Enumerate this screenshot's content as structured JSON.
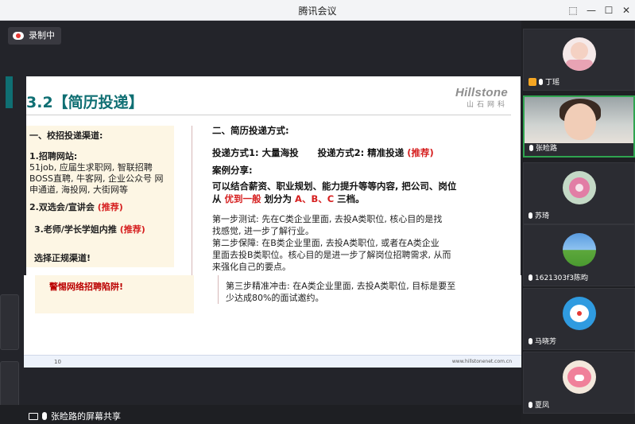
{
  "window": {
    "title": "腾讯会议",
    "controls": [
      "pin-icon",
      "minimize-icon",
      "maximize-icon",
      "close-icon"
    ]
  },
  "recording": {
    "label": "录制中"
  },
  "slide": {
    "heading": "3.2【简历投递】",
    "brand_name": "Hillstone",
    "brand_sub": "山石网科",
    "left": {
      "title": "一、校招投递渠道:",
      "item1_title": "1.招聘网站:",
      "item1_body": "51job, 应届生求职网, 智联招聘 BOSS直聘, 牛客网, 企业公众号 网申通道, 海投网, 大街网等",
      "item2_text": "2.双选会/宣讲会",
      "item2_tag": "(推荐)",
      "item3_text": "3.老师/学长学姐内推",
      "item3_tag": "(推荐)",
      "item4_text": "选择正规渠道!",
      "warning": "警惕网络招聘陷阱!"
    },
    "right": {
      "title": "二、简历投递方式:",
      "method1": "投递方式1: 大量海投",
      "method2": "投递方式2: 精准投递",
      "method2_tag": "(推荐)",
      "case_title": "案例分享:",
      "case_line1": "可以结合薪资、职业规划、能力提升等等内容, 把公司、岗位",
      "case_line2_prefix": "从",
      "case_line2_red1": "优到一般",
      "case_line2_mid": "划分为",
      "case_line2_red2": "A、B、C",
      "case_line2_suffix": "三档。",
      "step1": "第一步测试: 先在C类企业里面, 去投A类职位, 核心目的是找",
      "step1b": "找感觉, 进一步了解行业。",
      "step2": "第二步保障: 在B类企业里面, 去投A类职位, 或者在A类企业",
      "step2b": "里面去投B类职位。核心目的是进一步了解岗位招聘需求, 从而",
      "step2c": "来强化自己的要点。",
      "step3": "第三步精准冲击: 在A类企业里面, 去投A类职位, 目标是要至",
      "step3b": "少达成80%的面试邀约。"
    },
    "footer": {
      "page": "10",
      "url": "www.hillstonenet.com.cn"
    }
  },
  "share_label": "张睑路的屏幕共享",
  "participants": [
    {
      "name": "丁瑶",
      "type": "avatar",
      "host": true
    },
    {
      "name": "张睑路",
      "type": "video",
      "active": true
    },
    {
      "name": "苏琦",
      "type": "avatar"
    },
    {
      "name": "1621303f3陈昀",
      "type": "avatar"
    },
    {
      "name": "马晓芳",
      "type": "avatar"
    },
    {
      "name": "夏凤",
      "type": "avatar"
    }
  ],
  "colors": {
    "accent": "#0f6f73",
    "highlight_red": "#d62020",
    "active_border": "#2fa44f"
  }
}
